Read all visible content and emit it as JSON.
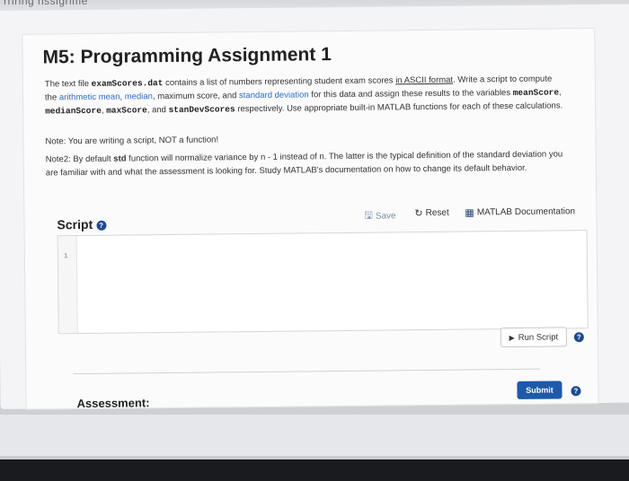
{
  "top_strip_text": "rriring nssigrime",
  "assignment": {
    "title": "M5: Programming Assignment 1",
    "p1": {
      "t1": "The text file ",
      "file": "examScores.dat",
      "t2": " contains a list of numbers representing student exam scores ",
      "ascii": "in ASCII format",
      "t3": ". Write a script to compute the ",
      "mean_link": "arithmetic mean",
      "t4": ", ",
      "median_link": "median",
      "t5": ", maximum score, and ",
      "std_link": "standard deviation",
      "t6": " for this data and assign these results to the variables ",
      "v1": "meanScore",
      "t7": ", ",
      "v2": "medianScore",
      "t8": ", ",
      "v3": "maxScore",
      "t9": ", and ",
      "v4": "stanDevScores",
      "t10": " respectively. Use appropriate built-in MATLAB functions for each of these calculations."
    },
    "note1": "Note: You are writing a script, NOT a function!",
    "note2": {
      "t1": "Note2: By default",
      "std": "std",
      "t2": " function will normalize variance by n - 1 instead of n. The latter is the typical definition of the standard deviation you are familiar with and what the assessment is looking for. Study MATLAB's documentation on how to change its default behavior."
    }
  },
  "script": {
    "label": "Script",
    "save": "Save",
    "reset": "Reset",
    "docs": "MATLAB Documentation",
    "line_number": "1",
    "run": "Run Script"
  },
  "assessment": {
    "label": "Assessment:",
    "submit": "Submit"
  },
  "colors": {
    "link": "#2a6ec6",
    "submit_bg": "#1e5aa8",
    "help_icon": "#1d4b8f"
  },
  "icons": [
    "save-icon",
    "reset-icon",
    "book-icon",
    "play-icon",
    "help-icon"
  ]
}
